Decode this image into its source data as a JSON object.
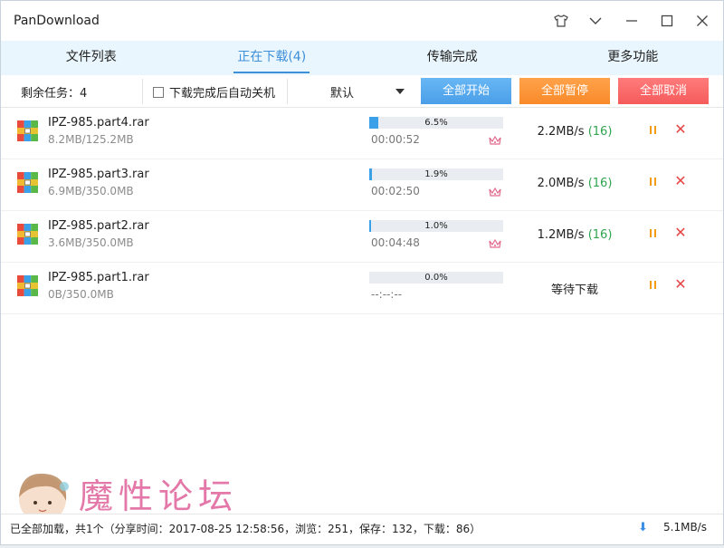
{
  "window": {
    "title": "PanDownload",
    "controls": [
      "shirt-icon",
      "chevron-down-icon",
      "minimize-icon",
      "maximize-icon",
      "close-icon"
    ]
  },
  "tabs": [
    {
      "label": "文件列表",
      "active": false
    },
    {
      "label": "正在下载(4)",
      "active": true
    },
    {
      "label": "传输完成",
      "active": false
    },
    {
      "label": "更多功能",
      "active": false
    }
  ],
  "toolbar": {
    "remaining": "剩余任务：4",
    "auto_shutdown_label": "下载完成后自动关机",
    "auto_shutdown_checked": false,
    "sort_value": "默认",
    "start_all": "全部开始",
    "pause_all": "全部暂停",
    "cancel_all": "全部取消"
  },
  "downloads": [
    {
      "name": "IPZ-985.part4.rar",
      "size": "8.2MB/125.2MB",
      "progress": 6.5,
      "progress_label": "6.5%",
      "time": "00:00:52",
      "speed": "2.2MB/s",
      "connections": "(16)",
      "status": "",
      "vip": true
    },
    {
      "name": "IPZ-985.part3.rar",
      "size": "6.9MB/350.0MB",
      "progress": 1.9,
      "progress_label": "1.9%",
      "time": "00:02:50",
      "speed": "2.0MB/s",
      "connections": "(16)",
      "status": "",
      "vip": true
    },
    {
      "name": "IPZ-985.part2.rar",
      "size": "3.6MB/350.0MB",
      "progress": 1.0,
      "progress_label": "1.0%",
      "time": "00:04:48",
      "speed": "1.2MB/s",
      "connections": "(16)",
      "status": "",
      "vip": true
    },
    {
      "name": "IPZ-985.part1.rar",
      "size": "0B/350.0MB",
      "progress": 0.0,
      "progress_label": "0.0%",
      "time": "--:--:--",
      "speed": "",
      "connections": "",
      "status": "等待下载",
      "vip": false
    }
  ],
  "statusbar": {
    "text": "已全部加载，共1个（分享时间：2017-08-25 12:58:56，浏览：251，保存：132，下载：86）",
    "total_speed": "5.1MB/s"
  },
  "watermark": {
    "text": "魔性论坛",
    "url": "www.moxing.info"
  },
  "colors": {
    "accent": "#3d8fd9",
    "progress": "#3aa0e8",
    "start": "#4a9fe8",
    "pause": "#f98a2a",
    "cancel": "#f55b5b",
    "connections": "#2ea44f"
  }
}
